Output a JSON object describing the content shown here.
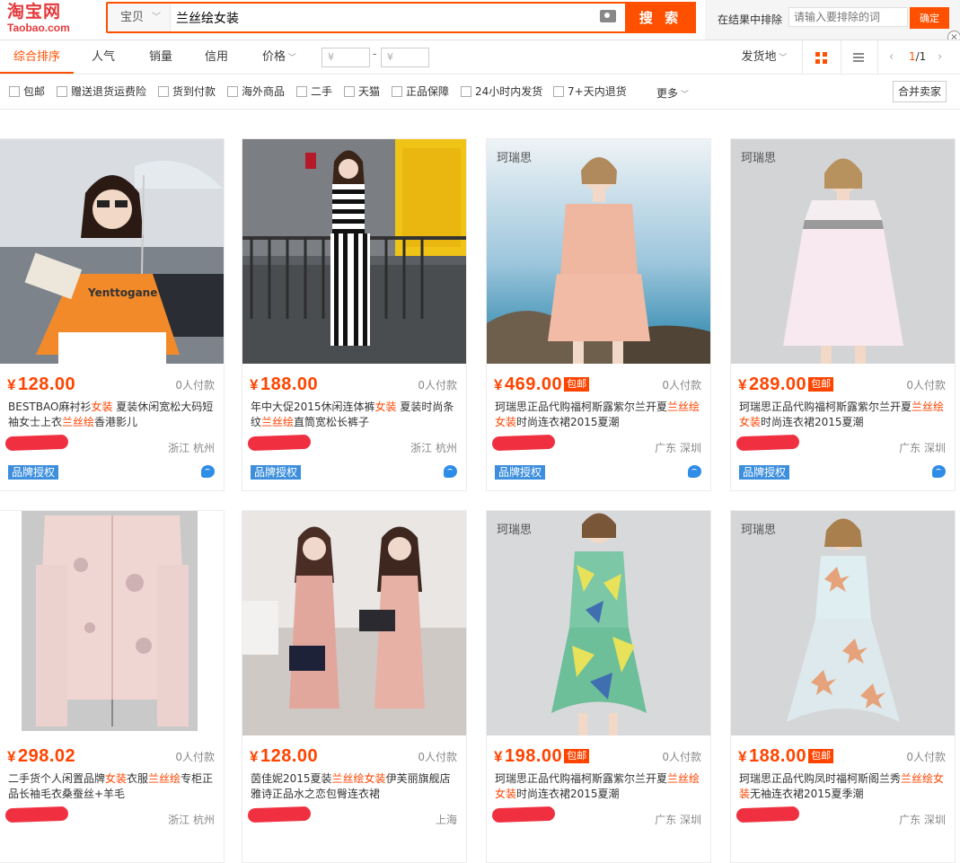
{
  "header": {
    "logo_cn": "淘宝网",
    "logo_en": "Taobao.com",
    "search_tab": "宝贝",
    "search_query": "兰丝绘女装",
    "search_button": "搜 索",
    "exclude_label": "在结果中排除",
    "exclude_placeholder": "请输入要排除的词",
    "exclude_button": "确定",
    "close_glyph": "×"
  },
  "sortbar": {
    "items": [
      "综合排序",
      "人气",
      "销量",
      "信用",
      "价格"
    ],
    "price_min_placeholder": "¥",
    "price_max_placeholder": "¥",
    "dash": "-",
    "ship_from": "发货地",
    "pager": {
      "current": "1",
      "total": "/1",
      "prev": "‹",
      "next": "›"
    },
    "view_mode": "grid"
  },
  "filters": {
    "items": [
      "包邮",
      "赠送退货运费险",
      "货到付款",
      "海外商品",
      "二手",
      "天猫",
      "正品保障",
      "24小时内发货",
      "7+天内退货"
    ],
    "more": "更多",
    "merge_sellers": "合并卖家"
  },
  "products": [
    {
      "price": "128.00",
      "paid": "0人付款",
      "title_html": "BESTBAO麻衬衫<em>女装</em> 夏装休闲宽松大码短袖女士上衣<em>兰丝绘</em>香港影儿",
      "location": "浙江 杭州",
      "baoyou": "",
      "brand_tag": "",
      "auth": "品牌授权"
    },
    {
      "price": "188.00",
      "paid": "0人付款",
      "title_html": "年中大促2015休闲连体裤<em>女装</em> 夏装时尚条纹<em>兰丝绘</em>直筒宽松长裤子",
      "location": "浙江 杭州",
      "baoyou": "",
      "brand_tag": "",
      "auth": "品牌授权"
    },
    {
      "price": "469.00",
      "paid": "0人付款",
      "title_html": "珂瑞思正品代购福柯斯露紫尔兰开夏<em>兰丝绘女装</em>时尚连衣裙2015夏潮",
      "location": "广东 深圳",
      "baoyou": "包邮",
      "brand_tag": "珂瑞思",
      "auth": "品牌授权"
    },
    {
      "price": "289.00",
      "paid": "0人付款",
      "title_html": "珂瑞思正品代购福柯斯露紫尔兰开夏<em>兰丝绘女装</em>时尚连衣裙2015夏潮",
      "location": "广东 深圳",
      "baoyou": "包邮",
      "brand_tag": "珂瑞思",
      "auth": "品牌授权"
    },
    {
      "price": "298.02",
      "paid": "0人付款",
      "title_html": "二手货个人闲置品牌<em>女装</em>衣服<em>兰丝绘</em>专柜正品长袖毛衣桑蚕丝+羊毛",
      "location": "浙江 杭州",
      "baoyou": "",
      "brand_tag": "",
      "auth": ""
    },
    {
      "price": "128.00",
      "paid": "0人付款",
      "title_html": "茵佳妮2015夏装<em>兰丝绘女装</em>伊芙丽旗舰店雅诗正品水之恋包臀连衣裙",
      "location": "上海",
      "baoyou": "",
      "brand_tag": "",
      "auth": ""
    },
    {
      "price": "198.00",
      "paid": "0人付款",
      "title_html": "珂瑞思正品代购福柯斯露紫尔兰开夏<em>兰丝绘女装</em>时尚连衣裙2015夏潮",
      "location": "广东 深圳",
      "baoyou": "包邮",
      "brand_tag": "珂瑞思",
      "auth": ""
    },
    {
      "price": "188.00",
      "paid": "0人付款",
      "title_html": "珂瑞思正品代购凤时福柯斯阁兰秀<em>兰丝绘女装</em>无袖连衣裙2015夏季潮",
      "location": "广东 深圳",
      "baoyou": "包邮",
      "brand_tag": "珂瑞思",
      "auth": ""
    }
  ],
  "currency": "¥",
  "colors": {
    "accent": "#ff5000",
    "price": "#ff4400",
    "auth_badge": "#3d8fdd"
  }
}
